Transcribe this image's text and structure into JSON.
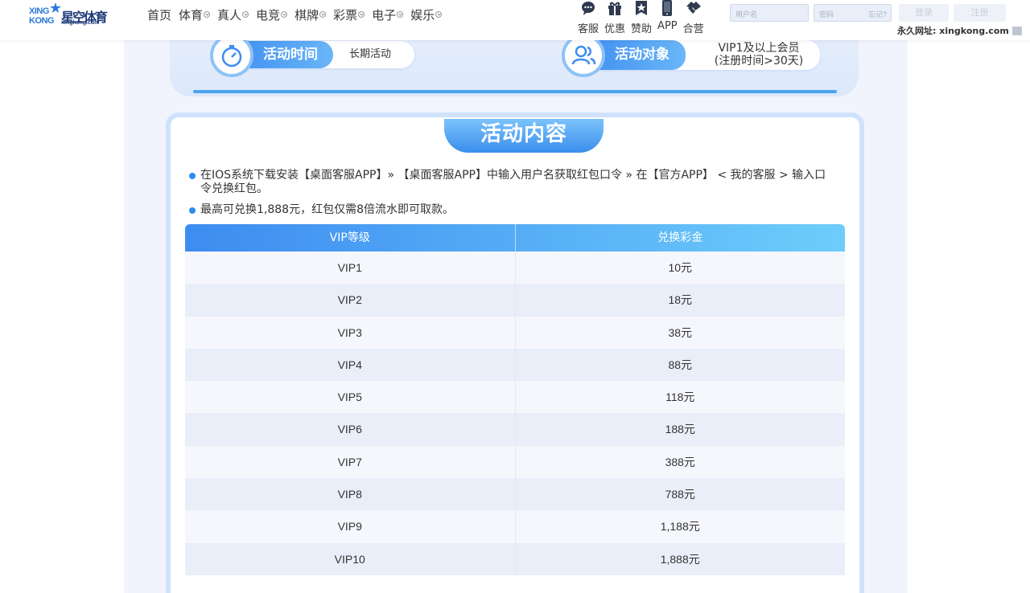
{
  "header": {
    "logo": {
      "xing": "XING",
      "kong": "KONG",
      "name_cn": "星空体育",
      "url": "xingkong.com"
    },
    "nav": [
      "首页",
      "体育",
      "真人",
      "电竞",
      "棋牌",
      "彩票",
      "电子",
      "娱乐"
    ],
    "tools": [
      {
        "label": "客服",
        "icon": "chat-icon"
      },
      {
        "label": "优惠",
        "icon": "gift-icon"
      },
      {
        "label": "赞助",
        "icon": "star-badge-icon"
      },
      {
        "label": "APP",
        "icon": "phone-icon"
      },
      {
        "label": "合营",
        "icon": "handshake-icon"
      }
    ],
    "login": {
      "username_placeholder": "用户名",
      "password_placeholder": "密码",
      "forgot_label": "忘记?",
      "login_button": "登录",
      "register_button": "注册"
    },
    "permanent_url": "永久网址: xingkong.com"
  },
  "activity": {
    "time_label": "活动时间",
    "time_value": "长期活动",
    "target_label": "活动对象",
    "target_value_line1": "VIP1及以上会员",
    "target_value_line2": "(注册时间>30天)"
  },
  "content": {
    "title": "活动内容",
    "bullets": [
      {
        "line1": "在IOS系统下载安装【桌面客服APP】» 【桌面客服APP】中输入用户名获取红包口令 » 在【官方APP】 < 我的客服 > 输入口",
        "line2": "令兑换红包。"
      },
      {
        "line1": "最高可兑换1,888元，红包仅需8倍流水即可取款。",
        "line2": ""
      }
    ],
    "table": {
      "headers": [
        "VIP等级",
        "兑换彩金"
      ],
      "rows": [
        [
          "VIP1",
          "10元"
        ],
        [
          "VIP2",
          "18元"
        ],
        [
          "VIP3",
          "38元"
        ],
        [
          "VIP4",
          "88元"
        ],
        [
          "VIP5",
          "118元"
        ],
        [
          "VIP6",
          "188元"
        ],
        [
          "VIP7",
          "388元"
        ],
        [
          "VIP8",
          "788元"
        ],
        [
          "VIP9",
          "1,188元"
        ],
        [
          "VIP10",
          "1,888元"
        ]
      ]
    }
  },
  "colors": {
    "accent": "#3d8cf0",
    "panel_bg": "#f2f4fd",
    "brand": "#1f3b78"
  }
}
